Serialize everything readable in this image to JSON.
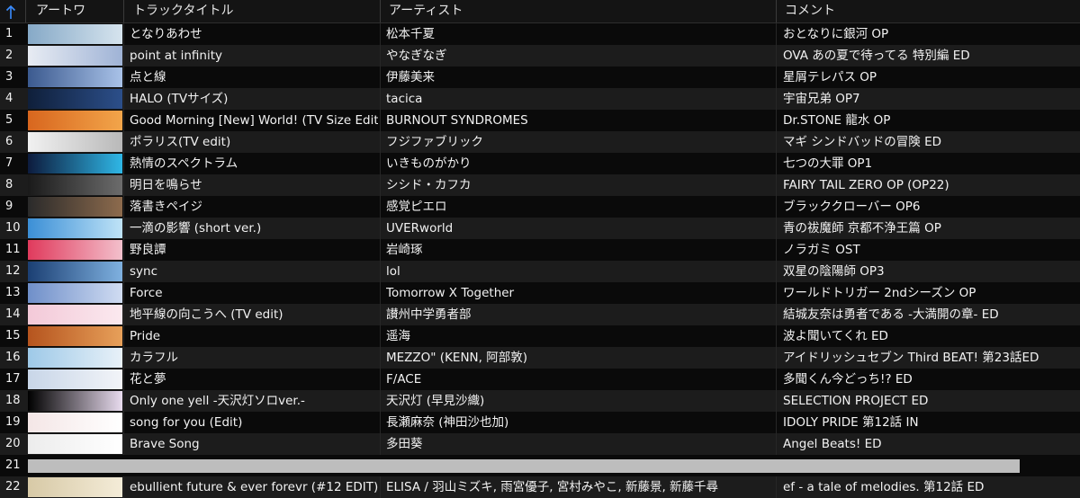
{
  "header": {
    "sort_arrow": "↑",
    "artwork": "アートワ",
    "title": "トラックタイトル",
    "artist": "アーティスト",
    "comment": "コメント"
  },
  "rows": [
    {
      "num": "1",
      "title": "となりあわせ",
      "artist": "松本千夏",
      "comment": "おとなりに銀河 OP",
      "art": [
        "#86a9c7",
        "#d6e4ee"
      ]
    },
    {
      "num": "2",
      "title": "point at infinity",
      "artist": "やなぎなぎ",
      "comment": "OVA あの夏で待ってる 特別編 ED",
      "art": [
        "#e8ecf3",
        "#9fb3d6"
      ]
    },
    {
      "num": "3",
      "title": "点と線",
      "artist": "伊藤美来",
      "comment": "星屑テレパス OP",
      "art": [
        "#3b5a8f",
        "#a9c2e8"
      ]
    },
    {
      "num": "4",
      "title": "HALO (TVサイズ)",
      "artist": "tacica",
      "comment": "宇宙兄弟 OP7",
      "art": [
        "#0f1f3a",
        "#2c4f8a"
      ]
    },
    {
      "num": "5",
      "title": "Good Morning [New] World! (TV Size Edit)",
      "artist": "BURNOUT SYNDROMES",
      "comment": "Dr.STONE 龍水 OP",
      "art": [
        "#d8661e",
        "#f2a54a"
      ]
    },
    {
      "num": "6",
      "title": "ポラリス(TV edit)",
      "artist": "フジファブリック",
      "comment": "マギ シンドバッドの冒険 ED",
      "art": [
        "#f1f1f1",
        "#b9b9b9"
      ]
    },
    {
      "num": "7",
      "title": "熱情のスペクトラム",
      "artist": "いきものがかり",
      "comment": "七つの大罪 OP1",
      "art": [
        "#0d1b3d",
        "#2fb7e6"
      ]
    },
    {
      "num": "8",
      "title": "明日を鳴らせ",
      "artist": "シシド・カフカ",
      "comment": "FAIRY TAIL ZERO OP (OP22)",
      "art": [
        "#1a1a1a",
        "#6c6c6c"
      ]
    },
    {
      "num": "9",
      "title": "落書きペイジ",
      "artist": "感覚ピエロ",
      "comment": "ブラッククローバー OP6",
      "art": [
        "#2a2a2a",
        "#8d6b4d"
      ]
    },
    {
      "num": "10",
      "title": "一滴の影響 (short ver.)",
      "artist": "UVERworld",
      "comment": "青の祓魔師 京都不浄王篇 OP",
      "art": [
        "#3b8fd6",
        "#bfe3f7"
      ]
    },
    {
      "num": "11",
      "title": "野良譚",
      "artist": "岩崎琢",
      "comment": "ノラガミ OST",
      "art": [
        "#e03a5c",
        "#f3c0cc"
      ]
    },
    {
      "num": "12",
      "title": "sync",
      "artist": "lol",
      "comment": "双星の陰陽師 OP3",
      "art": [
        "#1b3f73",
        "#7fb1e0"
      ]
    },
    {
      "num": "13",
      "title": "Force",
      "artist": "Tomorrow X Together",
      "comment": "ワールドトリガー 2ndシーズン OP",
      "art": [
        "#6f8fc9",
        "#d0dcf2"
      ]
    },
    {
      "num": "14",
      "title": "地平線の向こうへ (TV edit)",
      "artist": "讃州中学勇者部",
      "comment": "結城友奈は勇者である -大満開の章- ED",
      "art": [
        "#f3c9d8",
        "#fbe9ef"
      ]
    },
    {
      "num": "15",
      "title": "Pride",
      "artist": "遥海",
      "comment": "波よ聞いてくれ ED",
      "art": [
        "#b5541e",
        "#e7a05a"
      ]
    },
    {
      "num": "16",
      "title": "カラフル",
      "artist": "MEZZO\" (KENN, 阿部敦)",
      "comment": "アイドリッシュセブン Third BEAT! 第23話ED",
      "art": [
        "#9ec9e8",
        "#e8f1f8"
      ]
    },
    {
      "num": "17",
      "title": "花と夢",
      "artist": "F/ACE",
      "comment": "多聞くん今どっち!? ED",
      "art": [
        "#c8d6e8",
        "#f2f4f8"
      ]
    },
    {
      "num": "18",
      "title": "Only one yell -天沢灯ソロver.-",
      "artist": "天沢灯 (早見沙織)",
      "comment": "SELECTION PROJECT ED",
      "art": [
        "#000000",
        "#e9dcef"
      ]
    },
    {
      "num": "19",
      "title": "song for you (Edit)",
      "artist": "長瀬麻奈 (神田沙也加)",
      "comment": "IDOLY PRIDE 第12話 IN",
      "art": [
        "#f4e6e6",
        "#ffffff"
      ]
    },
    {
      "num": "20",
      "title": "Brave Song",
      "artist": "多田葵",
      "comment": "Angel Beats! ED",
      "art": [
        "#ececec",
        "#ffffff"
      ]
    },
    {
      "num": "21",
      "title": "",
      "artist": "",
      "comment": "",
      "art": null
    },
    {
      "num": "22",
      "title": "ebullient future & ever forevr (#12 EDIT)",
      "artist": "ELISA / 羽山ミズキ, 雨宮優子, 宮村みやこ, 新藤景, 新藤千尋",
      "comment": "ef - a tale of melodies. 第12話 ED",
      "art": [
        "#d7c9a6",
        "#f4ecd8"
      ]
    }
  ]
}
